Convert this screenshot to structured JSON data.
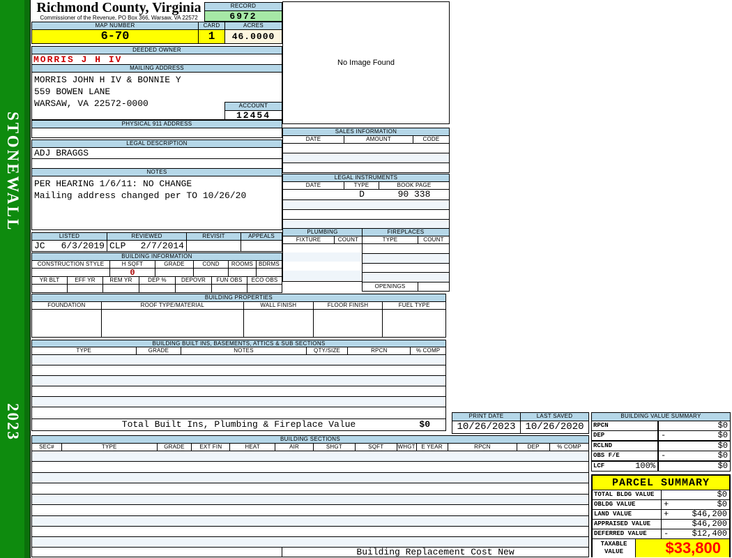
{
  "colors": {
    "header_bar_blue": "#b5d7e8",
    "highlight_yellow": "#ffff00",
    "record_green": "#a6e8a6",
    "acres_cream": "#fdf6df",
    "sidebar_green": "#0e8b0e",
    "owner_red": "#cc0000",
    "taxable_red": "#ff0000"
  },
  "sidebar": {
    "district": "STONEWALL",
    "year": "2023"
  },
  "header": {
    "county": "Richmond County, Virginia",
    "office_line": "Commissioner of the Revenue, PO Box 366, Warsaw, VA 22572",
    "record_label": "RECORD",
    "record_number": "6972",
    "map_number_label": "MAP NUMBER",
    "map_number": "6-70",
    "card_label": "CARD",
    "card_number": "1",
    "acres_label": "ACRES",
    "acres": "46.0000"
  },
  "owner": {
    "deeded_owner_label": "DEEDED OWNER",
    "deeded_owner": "MORRIS J H IV",
    "mailing_address_label": "MAILING ADDRESS",
    "mailing_lines": [
      "MORRIS JOHN H IV & BONNIE Y",
      "559 BOWEN LANE",
      "",
      "WARSAW, VA 22572-0000"
    ],
    "account_label": "ACCOUNT",
    "account_number": "12454",
    "physical_911_label": "PHYSICAL 911 ADDRESS",
    "physical_911_address": ""
  },
  "legal_description": {
    "label": "LEGAL DESCRIPTION",
    "text": "ADJ BRAGGS"
  },
  "notes": {
    "label": "NOTES",
    "lines": [
      "PER HEARING 1/6/11: NO CHANGE",
      "Mailing address changed per TO 10/26/20"
    ]
  },
  "review": {
    "listed_label": "LISTED",
    "listed_initials": "JC",
    "listed_date": "6/3/2019",
    "reviewed_label": "REVIEWED",
    "reviewed_initials": "CLP",
    "reviewed_date": "2/7/2014",
    "revisit_label": "REVISIT",
    "revisit": "",
    "appeals_label": "APPEALS",
    "appeals": ""
  },
  "building_information": {
    "title": "BUILDING INFORMATION",
    "row1_columns": [
      "CONSTRUCTION STYLE",
      "H SQFT",
      "GRADE",
      "COND",
      "ROOMS",
      "BDRMS"
    ],
    "h_sqft": "0",
    "row2_columns": [
      "YR BLT",
      "EFF YR",
      "REM YR",
      "DEP %",
      "DEPOVR",
      "FUN OBS",
      "ECO OBS"
    ]
  },
  "building_properties": {
    "title": "BUILDING PROPERTIES",
    "columns": [
      "FOUNDATION",
      "ROOF TYPE/MATERIAL",
      "WALL FINISH",
      "FLOOR FINISH",
      "FUEL TYPE"
    ]
  },
  "built_ins": {
    "title": "BUILDING BUILT INS, BASEMENTS, ATTICS & SUB SECTIONS",
    "columns": [
      "TYPE",
      "GRADE",
      "NOTES",
      "QTY/SIZE",
      "RPCN",
      "% COMP"
    ],
    "total_label": "Total Built Ins, Plumbing & Fireplace Value",
    "total_value": "$0"
  },
  "image_panel": {
    "message": "No Image Found"
  },
  "sales_information": {
    "title": "SALES INFORMATION",
    "columns": [
      "DATE",
      "AMOUNT",
      "CODE"
    ]
  },
  "legal_instruments": {
    "title": "LEGAL INSTRUMENTS",
    "columns": [
      "DATE",
      "TYPE",
      "BOOK PAGE"
    ],
    "rows": [
      {
        "date": "",
        "type": "D",
        "book_page": "90 338"
      }
    ]
  },
  "plumbing": {
    "title": "PLUMBING",
    "columns": [
      "FIXTURE",
      "COUNT"
    ]
  },
  "fireplaces": {
    "title": "FIREPLACES",
    "columns": [
      "TYPE",
      "COUNT"
    ],
    "openings_label": "OPENINGS"
  },
  "print_info": {
    "print_date_label": "PRINT DATE",
    "print_date": "10/26/2023",
    "last_saved_label": "LAST SAVED",
    "last_saved": "10/26/2020"
  },
  "building_value_summary": {
    "title": "BUILDING VALUE SUMMARY",
    "rows": [
      {
        "label": "RPCN",
        "pct": "",
        "sign": "",
        "value": "$0"
      },
      {
        "label": "DEP",
        "pct": "",
        "sign": "-",
        "value": "$0"
      },
      {
        "label": "RCLND",
        "pct": "",
        "sign": "",
        "value": "$0"
      },
      {
        "label": "OBS F/E",
        "pct": "",
        "sign": "-",
        "value": "$0"
      },
      {
        "label": "LCF",
        "pct": "100%",
        "sign": "",
        "value": "$0"
      }
    ]
  },
  "building_sections": {
    "title": "BUILDING SECTIONS",
    "columns": [
      "SEC#",
      "TYPE",
      "GRADE",
      "EXT FIN",
      "HEAT",
      "AIR",
      "SHGT",
      "SQFT",
      "WHGT",
      "E YEAR",
      "RPCN",
      "DEP",
      "% COMP"
    ],
    "footer_label": "Building Replacement Cost New"
  },
  "parcel_summary": {
    "title": "PARCEL SUMMARY",
    "rows": [
      {
        "label": "TOTAL BLDG VALUE",
        "sign": "",
        "value": "$0"
      },
      {
        "label": "OBLDG VALUE",
        "sign": "+",
        "value": "$0"
      },
      {
        "label": "LAND VALUE",
        "sign": "+",
        "value": "$46,200"
      },
      {
        "label": "APPRAISED VALUE",
        "sign": "",
        "value": "$46,200"
      },
      {
        "label": "DEFERRED VALUE",
        "sign": "-",
        "value": "$12,400"
      }
    ],
    "taxable_label": "TAXABLE VALUE",
    "taxable_value": "$33,800"
  }
}
